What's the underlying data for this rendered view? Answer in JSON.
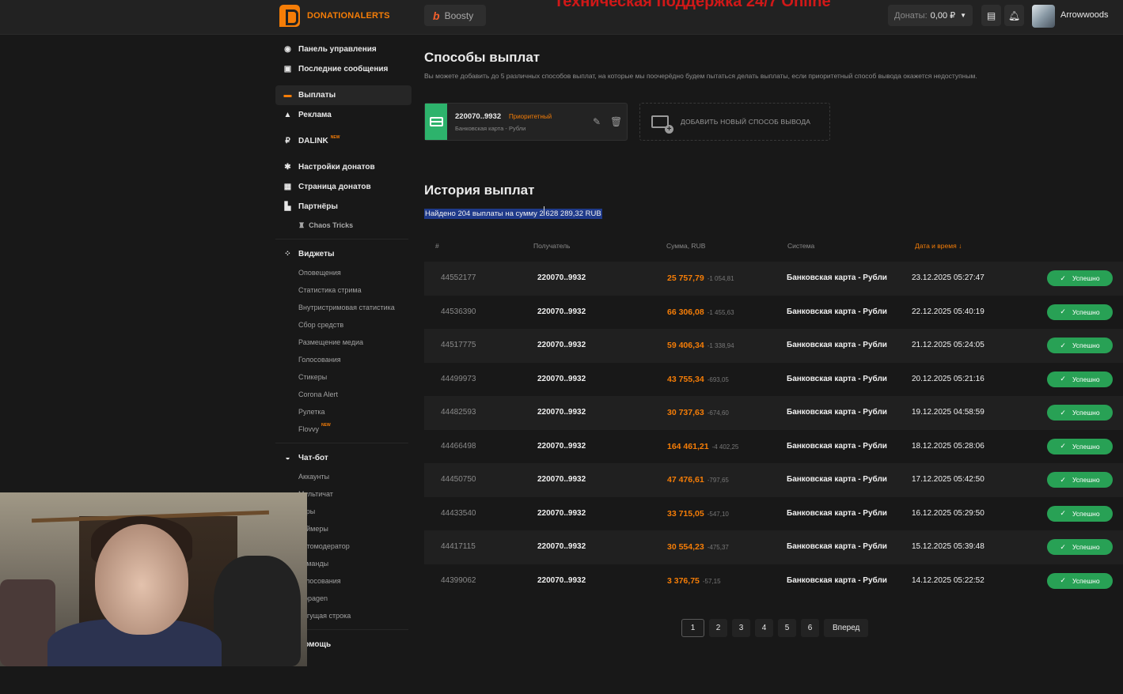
{
  "header": {
    "logo_text": "DONATIONALERTS",
    "boosty_label": "Boosty",
    "banner_text": "Техническая поддержка 24/7 Online",
    "donates_label": "Донаты:",
    "donates_value": "0,00 ₽",
    "username": "Arrowwoods",
    "colors": {
      "brand": "#f57d07",
      "success": "#28a155",
      "card_green": "#2db36c",
      "selection": "#1f3a8a"
    }
  },
  "sidebar": {
    "items": [
      {
        "label": "Панель управления",
        "icon": "dashboard-icon"
      },
      {
        "label": "Последние сообщения",
        "icon": "messages-icon"
      },
      {
        "label": "Выплаты",
        "icon": "wallet-icon",
        "active": true
      },
      {
        "label": "Реклама",
        "icon": "ads-icon"
      },
      {
        "label": "DALINK",
        "icon": "dalink-icon",
        "badge": "NEW"
      },
      {
        "label": "Настройки донатов",
        "icon": "gear-icon"
      },
      {
        "label": "Страница донатов",
        "icon": "page-icon"
      },
      {
        "label": "Партнёры",
        "icon": "partners-icon"
      },
      {
        "label": "Chaos Tricks",
        "icon": "joystick-icon"
      },
      {
        "label": "Виджеты",
        "icon": "widgets-icon"
      },
      {
        "label": "Чат-бот",
        "icon": "chatbot-icon"
      },
      {
        "label": "Помощь",
        "icon": "help-icon"
      }
    ],
    "widgets": [
      "Оповещения",
      "Статистика стрима",
      "Внутристримовая статистика",
      "Сбор средств",
      "Размещение медиа",
      "Голосования",
      "Стикеры",
      "Corona Alert",
      "Рулетка",
      "Flovvy"
    ],
    "flovvy_badge": "NEW",
    "chatbot": [
      "Аккаунты",
      "Мультичат",
      "Игры",
      "Таймеры",
      "Автомодератор",
      "Команды",
      "Голосования",
      "Oppagen",
      "Бегущая строка"
    ]
  },
  "payment_methods": {
    "title": "Способы выплат",
    "description": "Вы можете добавить до 5 различных способов выплат, на которые мы поочерёдно будем пытаться делать выплаты, если приоритетный способ вывода окажется недоступным.",
    "card": {
      "number": "220070..9932",
      "priority_label": "Приоритетный",
      "subtitle": "Банковская карта - Рубли"
    },
    "add_label": "Добавить новый способ вывода"
  },
  "history": {
    "title": "История выплат",
    "found_text": "Найдено 204 выплаты на сумму 2 628 289,32 RUB",
    "columns": {
      "id": "#",
      "recipient": "Получатель",
      "amount": "Сумма, RUB",
      "system": "Система",
      "date": "Дата и время ↓"
    },
    "rows": [
      {
        "id": "44552177",
        "recipient": "220070..9932",
        "amount": "25 757,79",
        "fee": "-1 054,81",
        "system": "Банковская карта - Рубли",
        "date": "23.12.2025 05:27:47",
        "status": "Успешно"
      },
      {
        "id": "44536390",
        "recipient": "220070..9932",
        "amount": "66 306,08",
        "fee": "-1 455,63",
        "system": "Банковская карта - Рубли",
        "date": "22.12.2025 05:40:19",
        "status": "Успешно"
      },
      {
        "id": "44517775",
        "recipient": "220070..9932",
        "amount": "59 406,34",
        "fee": "-1 338,94",
        "system": "Банковская карта - Рубли",
        "date": "21.12.2025 05:24:05",
        "status": "Успешно"
      },
      {
        "id": "44499973",
        "recipient": "220070..9932",
        "amount": "43 755,34",
        "fee": "-693,05",
        "system": "Банковская карта - Рубли",
        "date": "20.12.2025 05:21:16",
        "status": "Успешно"
      },
      {
        "id": "44482593",
        "recipient": "220070..9932",
        "amount": "30 737,63",
        "fee": "-674,60",
        "system": "Банковская карта - Рубли",
        "date": "19.12.2025 04:58:59",
        "status": "Успешно"
      },
      {
        "id": "44466498",
        "recipient": "220070..9932",
        "amount": "164 461,21",
        "fee": "-4 402,25",
        "system": "Банковская карта - Рубли",
        "date": "18.12.2025 05:28:06",
        "status": "Успешно"
      },
      {
        "id": "44450750",
        "recipient": "220070..9932",
        "amount": "47 476,61",
        "fee": "-797,65",
        "system": "Банковская карта - Рубли",
        "date": "17.12.2025 05:42:50",
        "status": "Успешно"
      },
      {
        "id": "44433540",
        "recipient": "220070..9932",
        "amount": "33 715,05",
        "fee": "-547,10",
        "system": "Банковская карта - Рубли",
        "date": "16.12.2025 05:29:50",
        "status": "Успешно"
      },
      {
        "id": "44417115",
        "recipient": "220070..9932",
        "amount": "30 554,23",
        "fee": "-475,37",
        "system": "Банковская карта - Рубли",
        "date": "15.12.2025 05:39:48",
        "status": "Успешно"
      },
      {
        "id": "44399062",
        "recipient": "220070..9932",
        "amount": "3 376,75",
        "fee": "-57,15",
        "system": "Банковская карта - Рубли",
        "date": "14.12.2025 05:22:52",
        "status": "Успешно"
      }
    ]
  },
  "pagination": {
    "pages": [
      "1",
      "2",
      "3",
      "4",
      "5",
      "6"
    ],
    "current": "1",
    "next_label": "Вперед"
  }
}
